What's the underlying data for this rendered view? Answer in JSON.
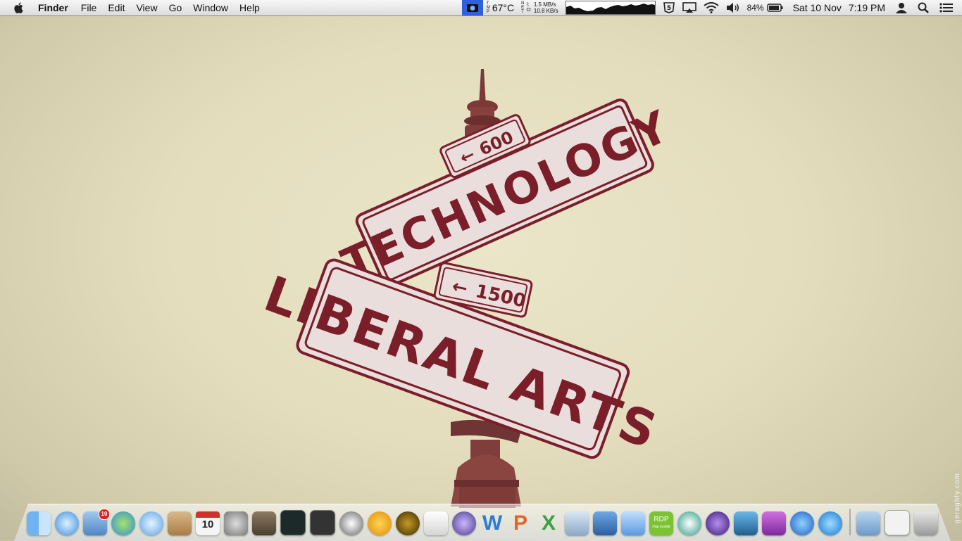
{
  "menubar": {
    "app_name": "Finder",
    "menus": [
      "File",
      "Edit",
      "View",
      "Go",
      "Window",
      "Help"
    ],
    "temperature": "67°C",
    "tmp_label": [
      "T",
      "M",
      "P"
    ],
    "net_labels": [
      "N",
      "E",
      "T"
    ],
    "net_in_label": "I:",
    "net_out_label": "O:",
    "net_in": "1.5 MB/s",
    "net_out": "10.8 KB/s",
    "battery_percent": "84%",
    "date": "Sat 10 Nov",
    "time": "7:19 PM"
  },
  "wallpaper": {
    "sign_top_number": "600",
    "sign_top_text": "TECHNOLOGY",
    "sign_bottom_number": "1500",
    "sign_bottom_text": "LIBERAL ARTS",
    "credit": "geraghty.com",
    "colors": {
      "sign_face": "#e8dcd8",
      "sign_border": "#7a1e2a",
      "pole": "#7a3a3a"
    }
  },
  "dock": {
    "mail_badge": "10",
    "ical_day": "10",
    "rdp_label": "RDP",
    "rdp_sub": "iTap mobile",
    "word_letter": "W",
    "powerpoint_letter": "P",
    "excel_letter": "X"
  }
}
